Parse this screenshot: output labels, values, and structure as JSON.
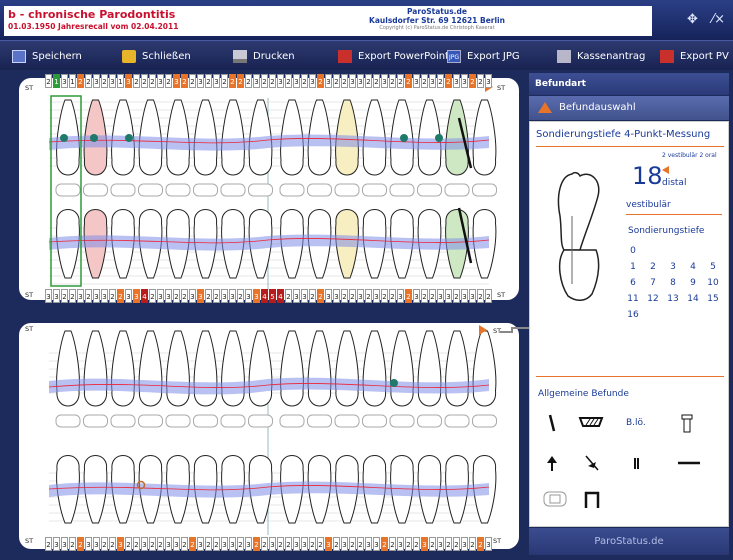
{
  "header": {
    "patient_name": "b - chronische Parodontitis",
    "patient_line": "01.03.1950 Jahresrecall vom 02.04.2011",
    "practice_name": "ParoStatus.de",
    "practice_address": "Kaulsdorfer Str. 69 12621 Berlin",
    "copyright": "Copyright (c) ParoStatus.de Christoph Kaserat"
  },
  "toolbar": {
    "save": "Speichern",
    "close": "Schließen",
    "print": "Drucken",
    "export_ppt": "Export PowerPoint",
    "export_jpg": "Export JPG",
    "kassenantrag": "Kassenantrag",
    "export_pv": "Export PV"
  },
  "chart": {
    "st_label": "ST",
    "upper_cells": [
      "2",
      "1",
      "3",
      "1",
      "2",
      "2",
      "3",
      "2",
      "3",
      "1",
      "3",
      "2",
      "2",
      "2",
      "3",
      "2",
      "3",
      "2",
      "2",
      "3",
      "2",
      "3",
      "2",
      "2",
      "2",
      "2",
      "3",
      "2",
      "2",
      "3",
      "2",
      "3",
      "2",
      "3",
      "2",
      "3",
      "2",
      "2",
      "3",
      "3",
      "2",
      "2",
      "3",
      "2",
      "2",
      "2",
      "3",
      "2",
      "3",
      "2",
      "2",
      "3",
      "3",
      "2",
      "2",
      "3"
    ],
    "upper_colors": [
      "w",
      "g",
      "w",
      "w",
      "o",
      "w",
      "w",
      "w",
      "w",
      "w",
      "o",
      "w",
      "w",
      "w",
      "w",
      "w",
      "o",
      "o",
      "w",
      "w",
      "w",
      "w",
      "w",
      "o",
      "o",
      "w",
      "w",
      "w",
      "w",
      "w",
      "w",
      "w",
      "w",
      "w",
      "o",
      "w",
      "w",
      "w",
      "w",
      "w",
      "w",
      "w",
      "w",
      "w",
      "w",
      "o",
      "w",
      "w",
      "w",
      "w",
      "o",
      "w",
      "w",
      "o",
      "w",
      "w"
    ],
    "mid_cells": [
      "3",
      "3",
      "2",
      "2",
      "3",
      "2",
      "3",
      "3",
      "2",
      "2",
      "3",
      "3",
      "4",
      "2",
      "3",
      "3",
      "2",
      "2",
      "3",
      "3",
      "2",
      "2",
      "3",
      "3",
      "2",
      "3",
      "3",
      "4",
      "5",
      "4",
      "2",
      "3",
      "3",
      "2",
      "2",
      "3",
      "3",
      "2",
      "2",
      "3",
      "2",
      "3",
      "2",
      "2",
      "3",
      "2",
      "3",
      "2",
      "2",
      "3",
      "3",
      "2",
      "3",
      "3",
      "2",
      "2"
    ],
    "mid_colors": [
      "w",
      "w",
      "w",
      "w",
      "w",
      "w",
      "w",
      "w",
      "w",
      "o",
      "w",
      "o",
      "r",
      "w",
      "w",
      "w",
      "w",
      "w",
      "w",
      "o",
      "w",
      "w",
      "w",
      "w",
      "w",
      "w",
      "o",
      "r",
      "r",
      "r",
      "w",
      "w",
      "w",
      "w",
      "o",
      "w",
      "w",
      "w",
      "w",
      "w",
      "w",
      "w",
      "w",
      "w",
      "w",
      "o",
      "w",
      "w",
      "w",
      "w",
      "w",
      "w",
      "w",
      "w",
      "w",
      "w"
    ],
    "lower_cells": [
      "2",
      "3",
      "3",
      "2",
      "2",
      "3",
      "3",
      "2",
      "2",
      "3",
      "2",
      "2",
      "3",
      "2",
      "2",
      "3",
      "3",
      "2",
      "2",
      "3",
      "2",
      "2",
      "3",
      "3",
      "2",
      "3",
      "2",
      "2",
      "3",
      "2",
      "2",
      "3",
      "3",
      "2",
      "2",
      "3",
      "2",
      "3",
      "2",
      "2",
      "3",
      "3",
      "2",
      "2",
      "3",
      "2",
      "2",
      "3",
      "2",
      "3",
      "2",
      "2",
      "3",
      "2",
      "2",
      "3"
    ],
    "lower_colors": [
      "w",
      "w",
      "w",
      "w",
      "o",
      "w",
      "w",
      "w",
      "w",
      "o",
      "w",
      "w",
      "w",
      "w",
      "w",
      "w",
      "w",
      "w",
      "o",
      "w",
      "w",
      "w",
      "w",
      "w",
      "w",
      "w",
      "o",
      "w",
      "w",
      "w",
      "w",
      "w",
      "w",
      "w",
      "w",
      "o",
      "w",
      "w",
      "w",
      "w",
      "w",
      "w",
      "o",
      "w",
      "w",
      "w",
      "w",
      "o",
      "w",
      "w",
      "w",
      "w",
      "w",
      "w",
      "o",
      "w"
    ]
  },
  "panel": {
    "header": "Befundart",
    "subheader": "Befundauswahl",
    "mode": "Sondierungstiefe  4-Punkt-Messung",
    "small_info": "2 vestibulär 2 oral",
    "tooth_number": "18",
    "side": "distal",
    "surface": "vestibulär",
    "depth_label": "Sondierungstiefe",
    "depths": [
      "0",
      "1",
      "2",
      "3",
      "4",
      "5",
      "6",
      "7",
      "8",
      "9",
      "10",
      "11",
      "12",
      "13",
      "14",
      "15",
      "16"
    ],
    "general_label": "Allgemeine Befunde",
    "blo_label": "B.lö.",
    "footer": "ParoStatus.de"
  },
  "colors": {
    "orange": "#e8742a",
    "red": "#b71c1c",
    "green": "#2e9b3a",
    "navy": "#1d2a5c",
    "accent_text": "#1a3a9a"
  }
}
